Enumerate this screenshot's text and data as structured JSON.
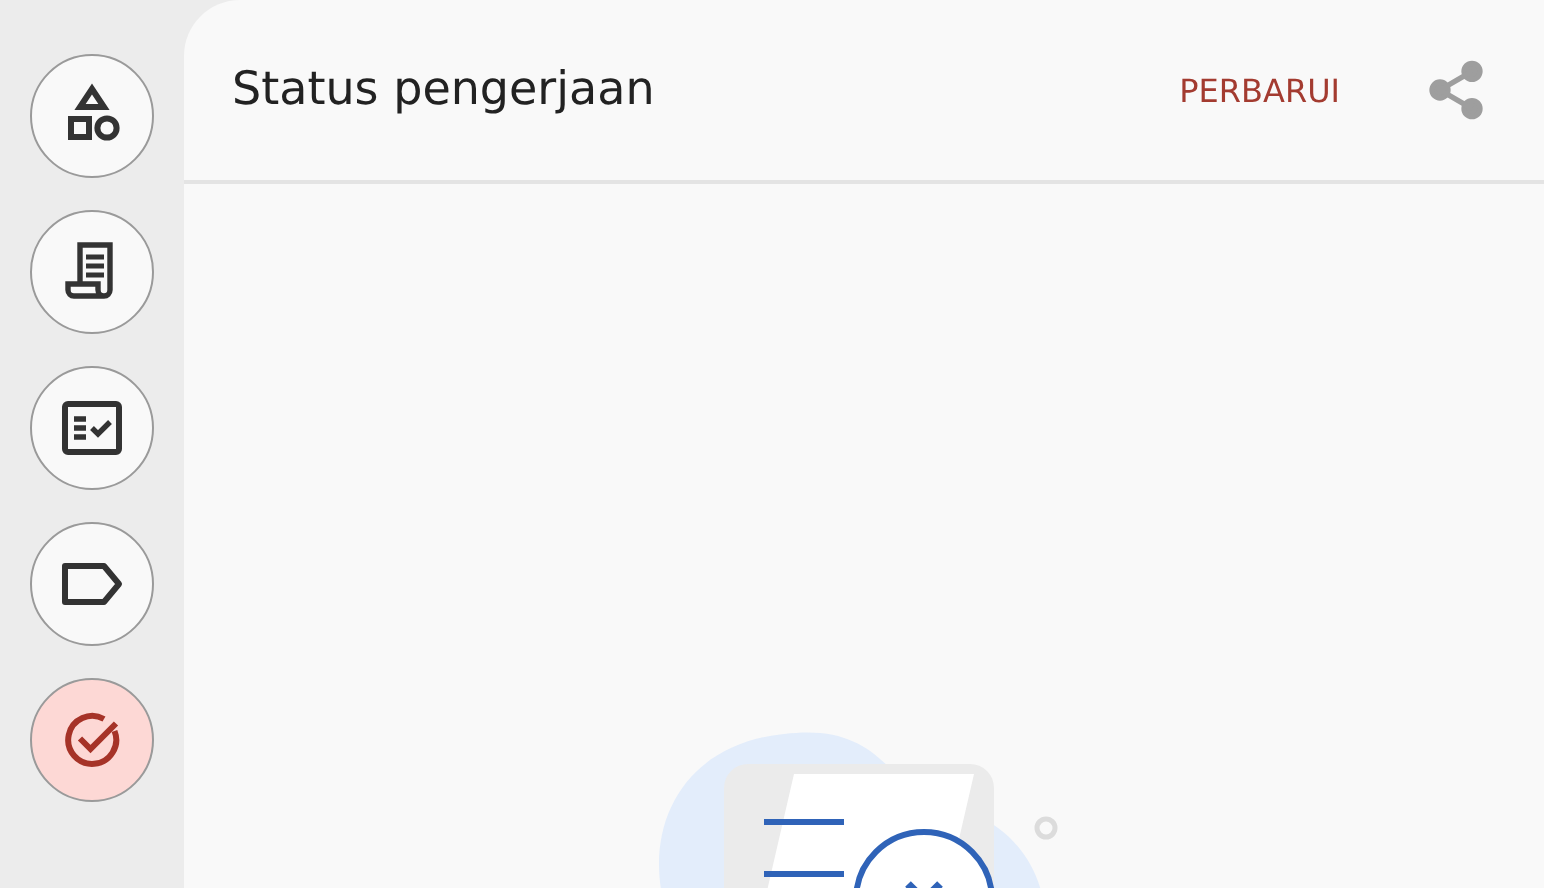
{
  "rail": {
    "items": [
      {
        "kind": "shapes",
        "selected": false
      },
      {
        "kind": "receipt",
        "selected": false
      },
      {
        "kind": "checklist",
        "selected": false
      },
      {
        "kind": "label",
        "selected": false
      },
      {
        "kind": "status",
        "selected": true
      }
    ]
  },
  "header": {
    "title": "Status pengerjaan",
    "action": "PERBARUI"
  }
}
